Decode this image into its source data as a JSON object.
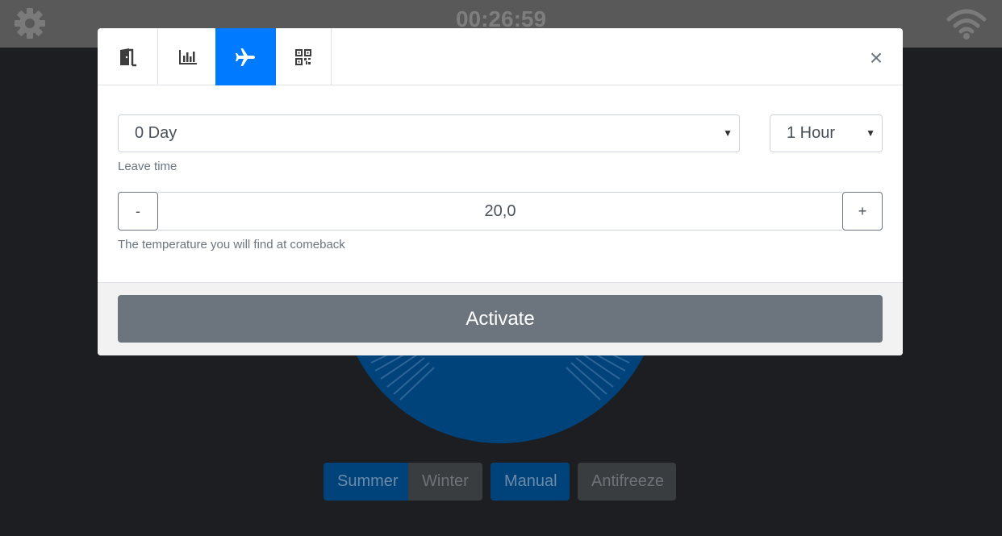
{
  "app": {
    "timer": "00:26:59",
    "modes": [
      {
        "label": "Summer",
        "active": true
      },
      {
        "label": "Winter",
        "active": false
      },
      {
        "label": "Manual",
        "active": true
      },
      {
        "label": "Antifreeze",
        "active": false
      }
    ]
  },
  "colors": {
    "accent": "#007bff",
    "activate_button": "#6c757d",
    "dial": "#00437a"
  },
  "modal": {
    "tabs": [
      {
        "icon": "door-exit-icon",
        "active": false
      },
      {
        "icon": "bar-chart-icon",
        "active": false
      },
      {
        "icon": "airplane-icon",
        "active": true
      },
      {
        "icon": "qr-code-icon",
        "active": false
      }
    ],
    "close_label": "×",
    "days_select": "0 Day",
    "hours_select": "1 Hour",
    "leave_time_label": "Leave time",
    "temp_minus": "-",
    "temp_value": "20,0",
    "temp_plus": "+",
    "temp_help": "The temperature you will find at comeback",
    "activate_label": "Activate"
  }
}
